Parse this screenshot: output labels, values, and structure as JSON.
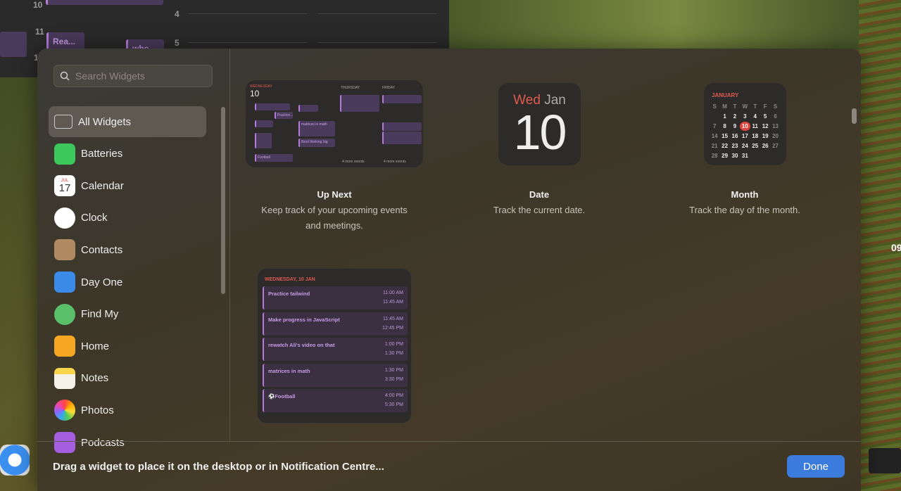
{
  "background_calendar": {
    "hours": [
      "10",
      "11",
      "1",
      "4",
      "5"
    ],
    "events": [
      "Rea...",
      "whe"
    ]
  },
  "desktop": {
    "clock_fragment": "09"
  },
  "search": {
    "placeholder": "Search Widgets"
  },
  "sidebar": {
    "items": [
      {
        "label": "All Widgets",
        "icon": "widgets-grid-icon",
        "selected": true
      },
      {
        "label": "Batteries",
        "icon": "battery-icon"
      },
      {
        "label": "Calendar",
        "icon": "calendar-icon",
        "icon_month": "JUL",
        "icon_day": "17"
      },
      {
        "label": "Clock",
        "icon": "clock-icon"
      },
      {
        "label": "Contacts",
        "icon": "contacts-icon"
      },
      {
        "label": "Day One",
        "icon": "bookmark-icon"
      },
      {
        "label": "Find My",
        "icon": "find-my-icon"
      },
      {
        "label": "Home",
        "icon": "home-icon"
      },
      {
        "label": "Notes",
        "icon": "notes-icon"
      },
      {
        "label": "Photos",
        "icon": "photos-icon"
      },
      {
        "label": "Podcasts",
        "icon": "podcasts-icon"
      }
    ]
  },
  "widgets": [
    {
      "title": "Up Next",
      "description": "Keep track of your upcoming events and meetings.",
      "preview": {
        "day_label": "WEDNESDAY",
        "day_num": "10",
        "col2": "THURSDAY",
        "col3": "FRIDAY",
        "more1": "4 more events",
        "more2": "4 more events",
        "events": [
          "Practice...",
          "Football",
          "flood thinking big",
          "matrices in math"
        ]
      }
    },
    {
      "title": "Date",
      "description": "Track the current date.",
      "preview": {
        "dow": "Wed",
        "month": "Jan",
        "day": "10"
      }
    },
    {
      "title": "Month",
      "description": "Track the day of the month.",
      "preview": {
        "month": "JANUARY",
        "weekdays": [
          "S",
          "M",
          "T",
          "W",
          "T",
          "F",
          "S"
        ],
        "today": 10,
        "first_weekday": 1,
        "days": 31
      }
    },
    {
      "title": "",
      "description": "",
      "preview": {
        "header": "WEDNESDAY, 10 JAN",
        "events": [
          {
            "name": "Practice tailwind",
            "start": "11:00 AM",
            "end": "11:45 AM"
          },
          {
            "name": "Make progress in JavaScript",
            "start": "11:45 AM",
            "end": "12:45 PM"
          },
          {
            "name": "rewatch Ali's video on that",
            "start": "1:00 PM",
            "end": "1:30 PM"
          },
          {
            "name": "matrices in math",
            "start": "1:30 PM",
            "end": "3:30 PM"
          },
          {
            "name": "⚽Football",
            "start": "4:00 PM",
            "end": "5:30 PM"
          }
        ]
      }
    }
  ],
  "footer": {
    "message": "Drag a widget to place it on the desktop or in Notification Centre...",
    "done_label": "Done"
  },
  "colors": {
    "accent": "#3a7bdc",
    "event_purple": "#b57bd8",
    "today_red": "#e0463c"
  }
}
